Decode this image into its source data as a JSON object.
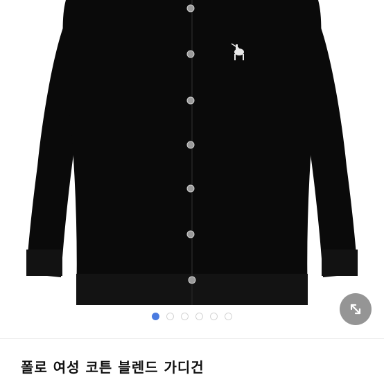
{
  "product": {
    "title": "폴로 여성 코튼 블렌드 가디건"
  },
  "gallery": {
    "image_count": 6,
    "active_index": 0,
    "active_color": "#4a7be0",
    "garment_color": "#0a0a0a",
    "expand_icon": "expand-arrows-icon"
  }
}
